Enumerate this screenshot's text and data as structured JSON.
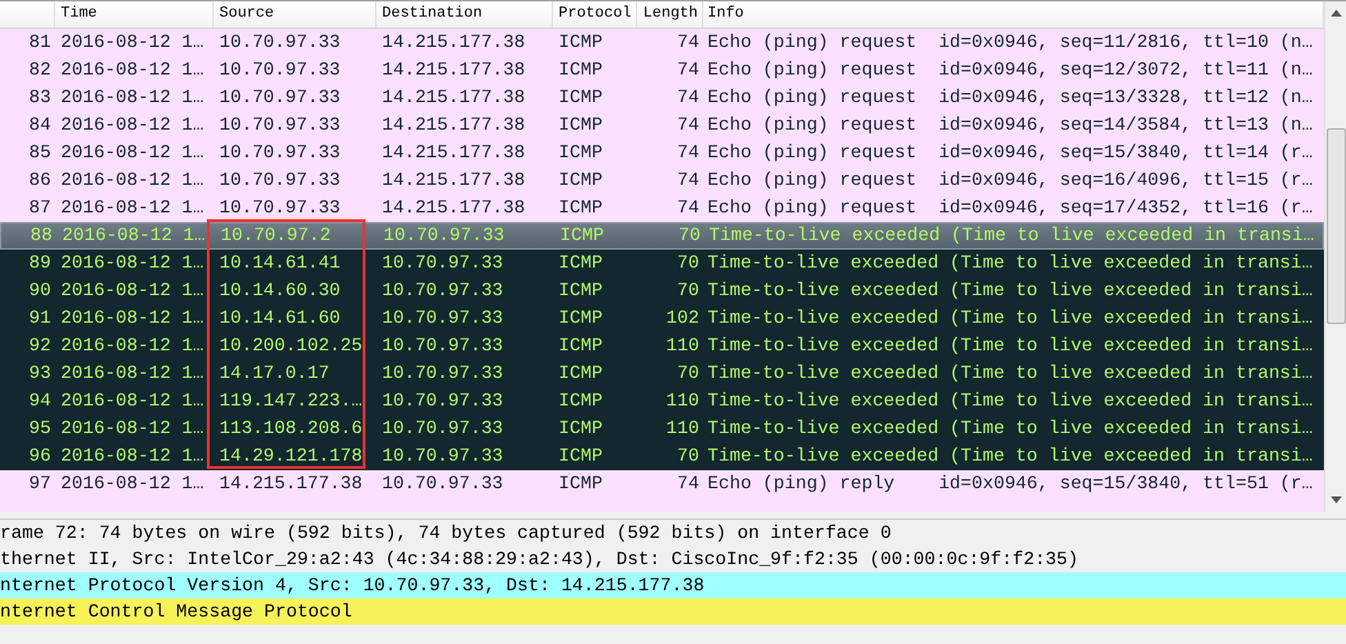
{
  "packet_list": {
    "columns": [
      {
        "label": "Time"
      },
      {
        "label": "Source"
      },
      {
        "label": "Destination"
      },
      {
        "label": "Protocol"
      },
      {
        "label": "Length"
      },
      {
        "label": "Info"
      }
    ],
    "rows": [
      {
        "number": "81",
        "kind": "echo",
        "selected": false,
        "boxed": false,
        "cells": [
          "2016-08-12 1…",
          "10.70.97.33",
          "14.215.177.38",
          "ICMP",
          "74",
          "Echo (ping) request  id=0x0946, seq=11/2816, ttl=10 (n…"
        ]
      },
      {
        "number": "82",
        "kind": "echo",
        "selected": false,
        "boxed": false,
        "cells": [
          "2016-08-12 1…",
          "10.70.97.33",
          "14.215.177.38",
          "ICMP",
          "74",
          "Echo (ping) request  id=0x0946, seq=12/3072, ttl=11 (n…"
        ]
      },
      {
        "number": "83",
        "kind": "echo",
        "selected": false,
        "boxed": false,
        "cells": [
          "2016-08-12 1…",
          "10.70.97.33",
          "14.215.177.38",
          "ICMP",
          "74",
          "Echo (ping) request  id=0x0946, seq=13/3328, ttl=12 (n…"
        ]
      },
      {
        "number": "84",
        "kind": "echo",
        "selected": false,
        "boxed": false,
        "cells": [
          "2016-08-12 1…",
          "10.70.97.33",
          "14.215.177.38",
          "ICMP",
          "74",
          "Echo (ping) request  id=0x0946, seq=14/3584, ttl=13 (n…"
        ]
      },
      {
        "number": "85",
        "kind": "echo",
        "selected": false,
        "boxed": false,
        "cells": [
          "2016-08-12 1…",
          "10.70.97.33",
          "14.215.177.38",
          "ICMP",
          "74",
          "Echo (ping) request  id=0x0946, seq=15/3840, ttl=14 (r…"
        ]
      },
      {
        "number": "86",
        "kind": "echo",
        "selected": false,
        "boxed": false,
        "cells": [
          "2016-08-12 1…",
          "10.70.97.33",
          "14.215.177.38",
          "ICMP",
          "74",
          "Echo (ping) request  id=0x0946, seq=16/4096, ttl=15 (r…"
        ]
      },
      {
        "number": "87",
        "kind": "echo",
        "selected": false,
        "boxed": false,
        "cells": [
          "2016-08-12 1…",
          "10.70.97.33",
          "14.215.177.38",
          "ICMP",
          "74",
          "Echo (ping) request  id=0x0946, seq=17/4352, ttl=16 (r…"
        ]
      },
      {
        "number": "88",
        "kind": "ttl_exceeded",
        "selected": true,
        "boxed": true,
        "cells": [
          "2016-08-12 1…",
          "10.70.97.2",
          "10.70.97.33",
          "ICMP",
          "70",
          "Time-to-live exceeded (Time to live exceeded in transi…"
        ]
      },
      {
        "number": "89",
        "kind": "ttl_exceeded",
        "selected": false,
        "boxed": true,
        "cells": [
          "2016-08-12 1…",
          "10.14.61.41",
          "10.70.97.33",
          "ICMP",
          "70",
          "Time-to-live exceeded (Time to live exceeded in transi…"
        ]
      },
      {
        "number": "90",
        "kind": "ttl_exceeded",
        "selected": false,
        "boxed": true,
        "cells": [
          "2016-08-12 1…",
          "10.14.60.30",
          "10.70.97.33",
          "ICMP",
          "70",
          "Time-to-live exceeded (Time to live exceeded in transi…"
        ]
      },
      {
        "number": "91",
        "kind": "ttl_exceeded",
        "selected": false,
        "boxed": true,
        "cells": [
          "2016-08-12 1…",
          "10.14.61.60",
          "10.70.97.33",
          "ICMP",
          "102",
          "Time-to-live exceeded (Time to live exceeded in transi…"
        ]
      },
      {
        "number": "92",
        "kind": "ttl_exceeded",
        "selected": false,
        "boxed": true,
        "cells": [
          "2016-08-12 1…",
          "10.200.102.25",
          "10.70.97.33",
          "ICMP",
          "110",
          "Time-to-live exceeded (Time to live exceeded in transi…"
        ]
      },
      {
        "number": "93",
        "kind": "ttl_exceeded",
        "selected": false,
        "boxed": true,
        "cells": [
          "2016-08-12 1…",
          "14.17.0.17",
          "10.70.97.33",
          "ICMP",
          "70",
          "Time-to-live exceeded (Time to live exceeded in transi…"
        ]
      },
      {
        "number": "94",
        "kind": "ttl_exceeded",
        "selected": false,
        "boxed": true,
        "cells": [
          "2016-08-12 1…",
          "119.147.223.…",
          "10.70.97.33",
          "ICMP",
          "110",
          "Time-to-live exceeded (Time to live exceeded in transi…"
        ]
      },
      {
        "number": "95",
        "kind": "ttl_exceeded",
        "selected": false,
        "boxed": true,
        "cells": [
          "2016-08-12 1…",
          "113.108.208.6",
          "10.70.97.33",
          "ICMP",
          "110",
          "Time-to-live exceeded (Time to live exceeded in transi…"
        ]
      },
      {
        "number": "96",
        "kind": "ttl_exceeded",
        "selected": false,
        "boxed": true,
        "cells": [
          "2016-08-12 1…",
          "14.29.121.178",
          "10.70.97.33",
          "ICMP",
          "70",
          "Time-to-live exceeded (Time to live exceeded in transi…"
        ]
      },
      {
        "number": "97",
        "kind": "echo",
        "selected": false,
        "boxed": false,
        "cells": [
          "2016-08-12 1…",
          "14.215.177.38",
          "10.70.97.33",
          "ICMP",
          "74",
          "Echo (ping) reply    id=0x0946, seq=15/3840, ttl=51 (r…"
        ]
      }
    ]
  },
  "packet_details": [
    {
      "text": "rame 72: 74 bytes on wire (592 bits), 74 bytes captured (592 bits) on interface 0",
      "color": "#f0f0f0"
    },
    {
      "text": "thernet II, Src: IntelCor_29:a2:43 (4c:34:88:29:a2:43), Dst: CiscoInc_9f:f2:35 (00:00:0c:9f:f2:35)",
      "color": "#f0f0f0"
    },
    {
      "text": "nternet Protocol Version 4, Src: 10.70.97.33, Dst: 14.215.177.38",
      "color": "#a0ffff"
    },
    {
      "text": "nternet Control Message Protocol",
      "color": "#f7f25a"
    }
  ]
}
